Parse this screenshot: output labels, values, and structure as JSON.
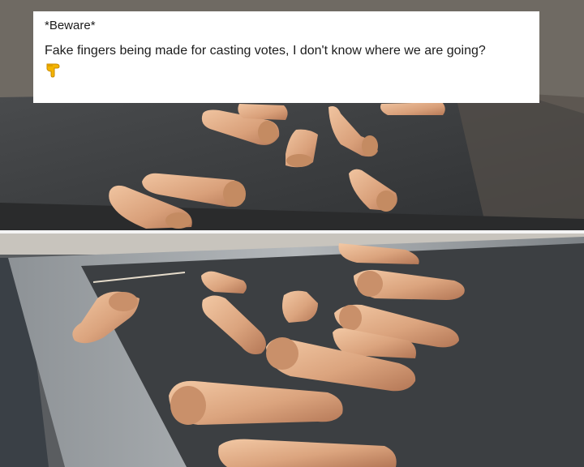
{
  "caption": {
    "title": "*Beware*",
    "body": "Fake fingers being made for casting votes, I don't know where we are going?",
    "emoji": "backhand-index-pointing-down"
  },
  "photos": [
    {
      "name": "top-photo",
      "subject": "fake silicone fingers on a dark tray"
    },
    {
      "name": "bottom-photo",
      "subject": "fake silicone fingers on a metal tray"
    }
  ],
  "colors": {
    "skin": "#d9a47c",
    "tray_dark": "#3b3d3f",
    "tray_metal": "#9da2a6"
  }
}
